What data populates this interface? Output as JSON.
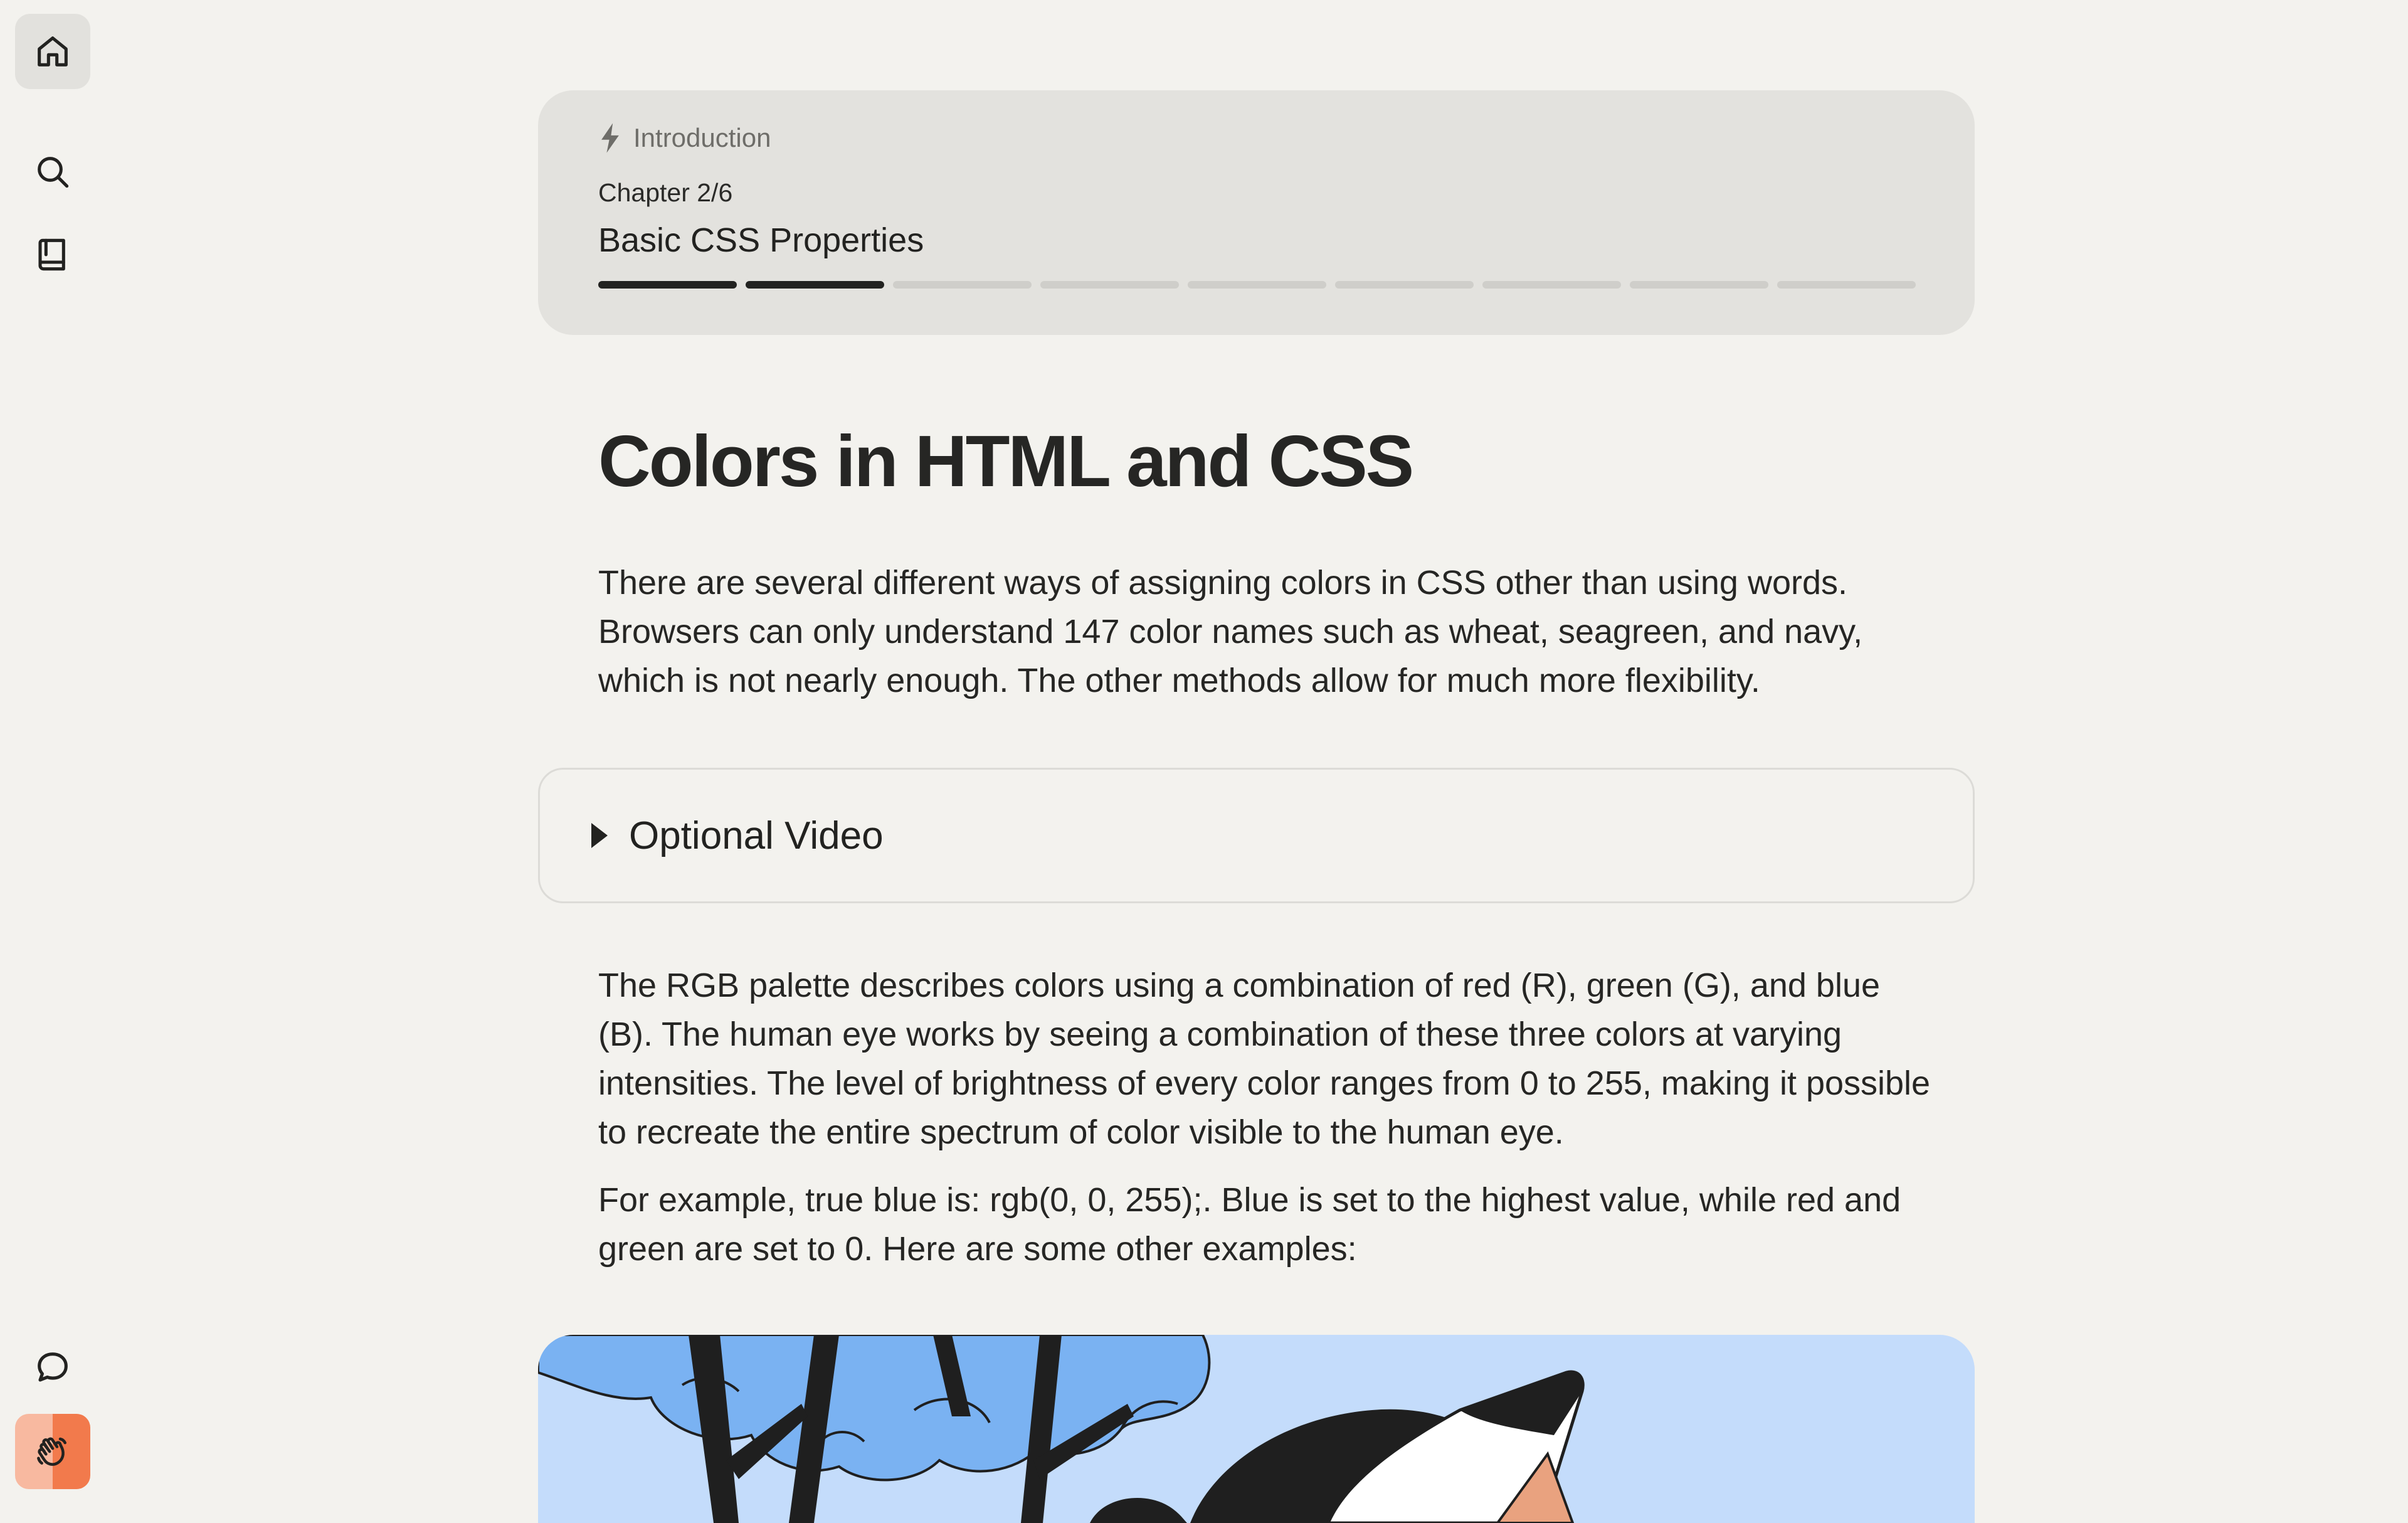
{
  "nav": {
    "items": [
      {
        "name": "home",
        "icon": "home-icon",
        "active": true
      },
      {
        "name": "search",
        "icon": "search-icon"
      },
      {
        "name": "book",
        "icon": "book-icon"
      },
      {
        "name": "chat",
        "icon": "chat-bubble-icon"
      },
      {
        "name": "wave",
        "icon": "waving-hand-icon"
      }
    ]
  },
  "chapter_card": {
    "section": "Introduction",
    "chapter_number": "Chapter 2/6",
    "chapter_title": "Basic CSS Properties",
    "progress": {
      "completed": 2,
      "total": 9
    }
  },
  "lesson": {
    "title": "Colors in HTML and CSS",
    "intro": "There are several different ways of assigning colors in CSS other than using words. Browsers can only understand 147 color names such as wheat, seagreen, and navy, which is not nearly enough. The other methods allow for much more flexibility.",
    "video_toggle_label": "Optional Video",
    "rgb_paragraph": "The RGB palette describes colors using a combination of red (R), green (G), and blue (B). The human eye works by seeing a combination of these three colors at varying intensities. The level of brightness of every color ranges from 0 to 255, making it possible to recreate the entire spectrum of color visible to the human eye.",
    "example_paragraph": "For example, true blue is: rgb(0, 0, 255);. Blue is set to the highest value, while red and green are set to 0. Here are some other examples:"
  },
  "colors": {
    "background": "#f3f2ee",
    "card": "#e3e2de",
    "text": "#222220",
    "progress_done": "#222220",
    "progress_todo": "#cfceca",
    "illustration_sky": "#c4dcfb",
    "illustration_foliage": "#7ab2f2",
    "accent_orange": "#f27a4c"
  }
}
